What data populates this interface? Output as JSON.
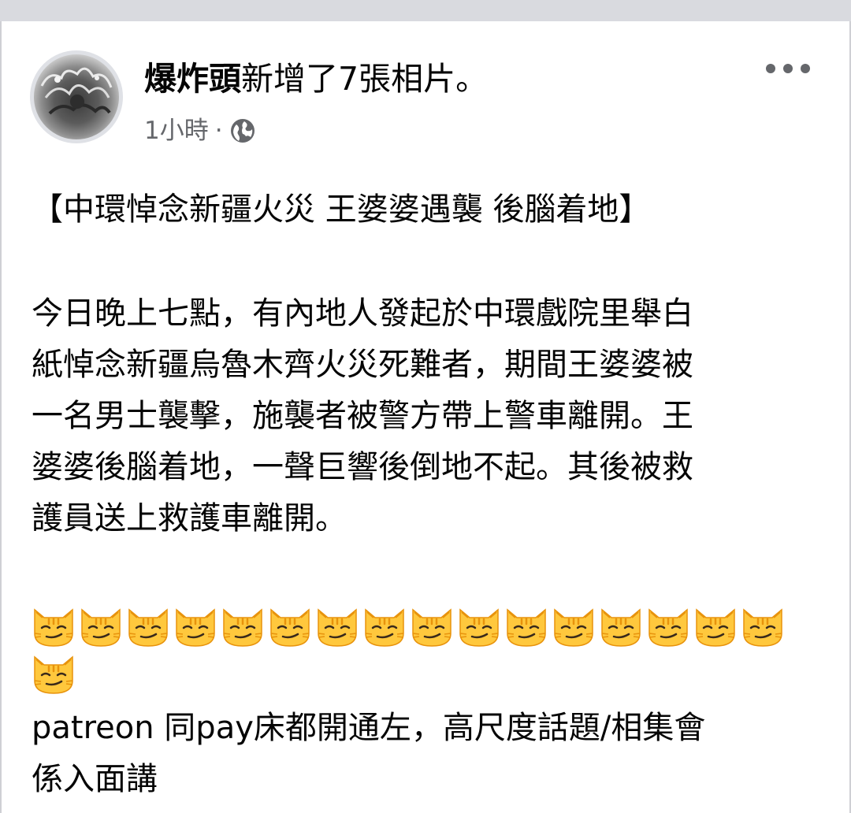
{
  "post": {
    "author": "爆炸頭",
    "action": "新增了7張相片。",
    "time": "1小時",
    "separator": "·",
    "privacy_icon": "globe-icon",
    "headline": "【中環悼念新疆火災 王婆婆遇襲 後腦着地】",
    "body_lines": [
      "今日晚上七點，有內地人發起於中環戲院里舉白",
      "紙悼念新疆烏魯木齊火災死難者，期間王婆婆被",
      "一名男士襲擊，施襲者被警方帶上警車離開。王",
      "婆婆後腦着地，一聲巨響後倒地不起。其後被救",
      "護員送上救護車離開。"
    ],
    "emoji_icon": "smirking-cat-emoji",
    "emoji_count": 17,
    "emoji_per_row": 16,
    "footer_lines": [
      "patreon 同pay床都開通左，高尺度話題/相集會",
      "係入面講"
    ]
  },
  "colors": {
    "top_bar": "#d9dadf",
    "text": "#050505",
    "secondary_text": "#65676b",
    "cat_face": "#ffc83d",
    "cat_stripes": "#e8930c"
  }
}
